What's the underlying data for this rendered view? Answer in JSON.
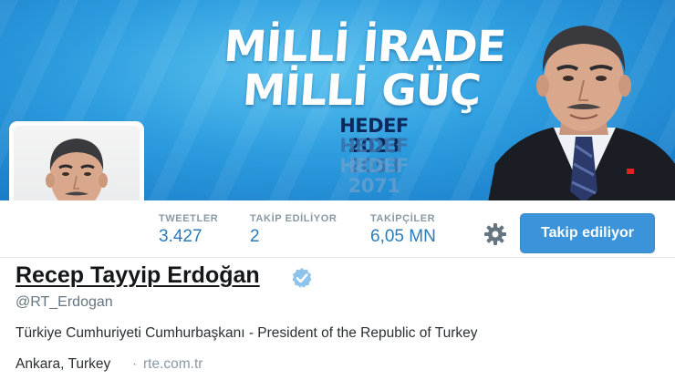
{
  "banner": {
    "slogan_line1": "MİLLİ İRADE",
    "slogan_line2": "MİLLİ GÜÇ",
    "targets": [
      "HEDEF 2023",
      "HEDEF 2053",
      "HEDEF 2071"
    ]
  },
  "profile": {
    "name": "Recep Tayyip Erdoğan",
    "handle": "@RT_Erdogan",
    "bio": "Türkiye Cumhuriyeti Cumhurbaşkanı - President of the Republic of Turkey",
    "location": "Ankara, Turkey",
    "separator": "·",
    "website": "rte.com.tr",
    "verified": true
  },
  "stats": [
    {
      "label": "TWEETLER",
      "value": "3.427"
    },
    {
      "label": "TAKİP EDİLİYOR",
      "value": "2"
    },
    {
      "label": "TAKİPÇİLER",
      "value": "6,05 MN"
    }
  ],
  "actions": {
    "follow_button_label": "Takip ediliyor",
    "settings_icon": "gear-icon",
    "verified_icon": "verified-badge-icon"
  },
  "colors": {
    "banner_blue": "#2d9ddf",
    "link_blue": "#2b7bb9",
    "button_blue": "#3b94d9",
    "muted": "#8899a6",
    "text": "#292f33"
  }
}
